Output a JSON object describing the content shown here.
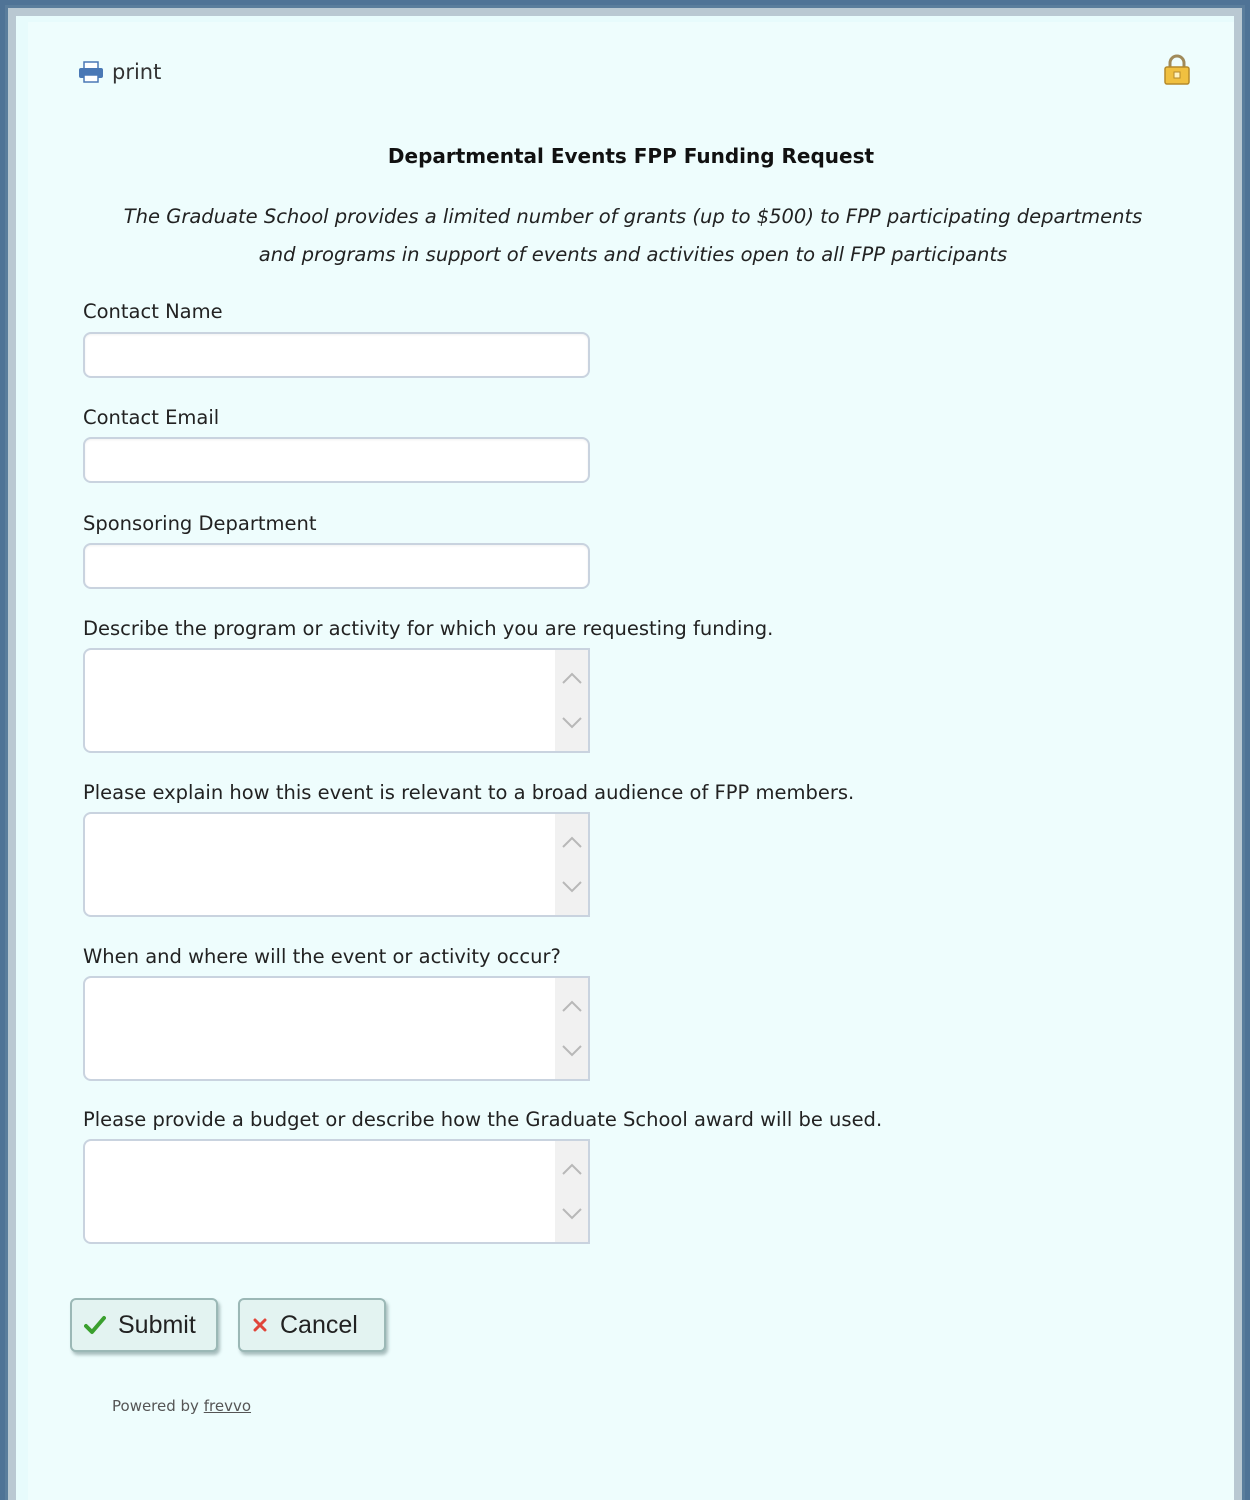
{
  "toolbar": {
    "print_label": "print",
    "print_icon": "printer-icon",
    "lock_icon": "lock-icon"
  },
  "form": {
    "title": "Departmental Events FPP Funding Request",
    "description_line1": "The Graduate School provides a limited number of grants (up to $500) to FPP participating departments",
    "description_line2": "and programs in support of events and activities open to all FPP participants",
    "fields": {
      "contact_name": {
        "label": "Contact Name",
        "value": ""
      },
      "contact_email": {
        "label": "Contact Email",
        "value": ""
      },
      "sponsoring_department": {
        "label": "Sponsoring Department",
        "value": ""
      },
      "program_description": {
        "label": "Describe the program or activity for which you are requesting funding.",
        "value": ""
      },
      "relevance": {
        "label": "Please explain how this event is relevant to a broad audience of FPP members.",
        "value": ""
      },
      "when_where": {
        "label": "When and where will the event or activity occur?",
        "value": ""
      },
      "budget": {
        "label": "Please provide a budget or describe how the Graduate School award will be used.",
        "value": ""
      }
    }
  },
  "actions": {
    "submit_label": "Submit",
    "cancel_label": "Cancel"
  },
  "footer": {
    "powered_prefix": "Powered by",
    "powered_link": "frevvo"
  },
  "colors": {
    "background": "#eefdfd",
    "outer_border": "#4f7396",
    "submit_check": "#3aa02e",
    "cancel_x": "#e0453a"
  }
}
